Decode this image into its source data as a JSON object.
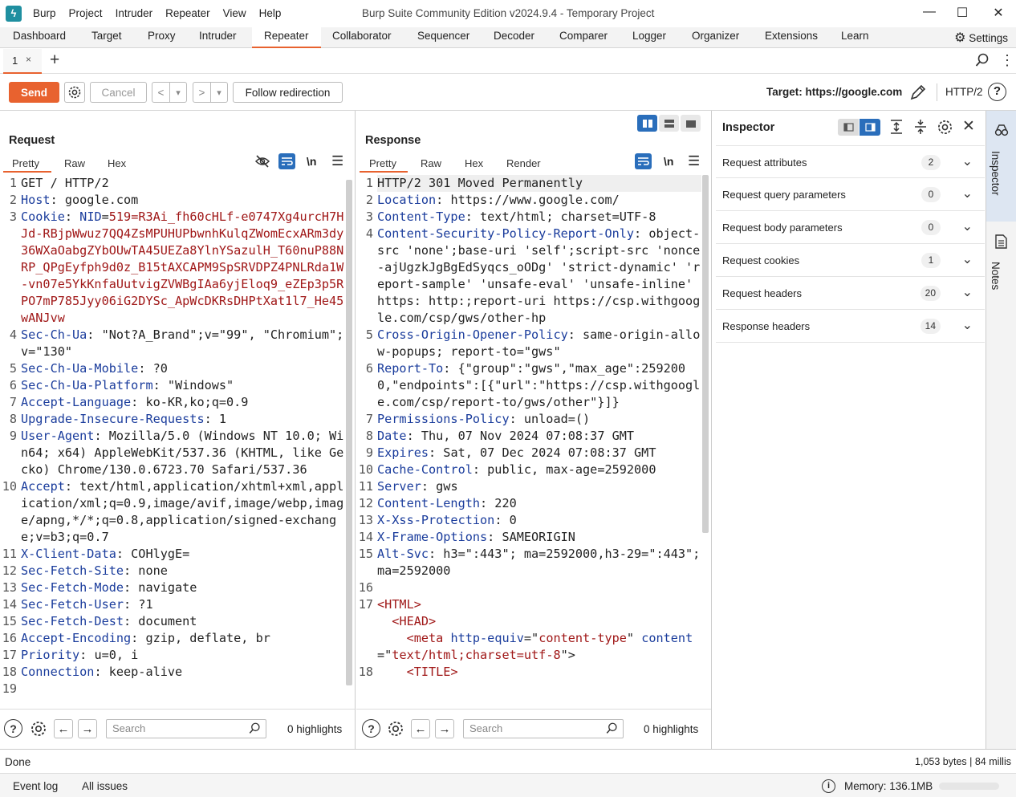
{
  "app": {
    "menu": [
      "Burp",
      "Project",
      "Intruder",
      "Repeater",
      "View",
      "Help"
    ],
    "window_title": "Burp Suite Community Edition v2024.9.4 - Temporary Project",
    "controls": {
      "minimize": "—",
      "maximize": "☐",
      "close": "✕"
    }
  },
  "main_tabs": [
    "Dashboard",
    "Target",
    "Proxy",
    "Intruder",
    "Repeater",
    "Collaborator",
    "Sequencer",
    "Decoder",
    "Comparer",
    "Logger",
    "Organizer",
    "Extensions",
    "Learn"
  ],
  "active_main_tab": "Repeater",
  "settings_label": "Settings",
  "repeater_tabs": [
    {
      "label": "1",
      "close": "×"
    }
  ],
  "add_tab": "+",
  "toolbar": {
    "send": "Send",
    "cancel": "Cancel",
    "back": "<",
    "forward": ">",
    "dropdown": "▾",
    "follow": "Follow redirection",
    "target_label": "Target: https://google.com",
    "protocol": "HTTP/2"
  },
  "request": {
    "title": "Request",
    "tabs": [
      "Pretty",
      "Raw",
      "Hex"
    ],
    "active_tab": "Pretty",
    "newline_toggle": "\\n",
    "lines": [
      {
        "n": "1",
        "parts": [
          [
            "",
            "GET / HTTP/2"
          ]
        ]
      },
      {
        "n": "2",
        "parts": [
          [
            "h",
            "Host"
          ],
          [
            "",
            ": google.com"
          ]
        ]
      },
      {
        "n": "3",
        "parts": [
          [
            "h",
            "Cookie"
          ],
          [
            "",
            ": "
          ],
          [
            "h",
            "NID"
          ],
          [
            "",
            "="
          ],
          [
            "c",
            "519=R3Ai_fh60cHLf-e0747Xg4urcH7HJd-RBjpWwuz7QQ4ZsMPUHUPbwnhKulqZWomEcxARm3dy36WXaOabgZYbOUwTA45UEZa8YlnYSazulH_T60nuP88NRP_QPgEyfph9d0z_B15tAXCAPM9SpSRVDPZ4PNLRda1W-vn07e5YkKnfaUutvigZVWBgIAa6yjEloq9_eZEp3p5RPO7mP785Jyy06iG2DYSc_ApWcDKRsDHPtXat1l7_He45wANJvw"
          ]
        ]
      },
      {
        "n": "4",
        "parts": [
          [
            "h",
            "Sec-Ch-Ua"
          ],
          [
            "",
            ": \"Not?A_Brand\";v=\"99\", \"Chromium\";v=\"130\""
          ]
        ]
      },
      {
        "n": "5",
        "parts": [
          [
            "h",
            "Sec-Ch-Ua-Mobile"
          ],
          [
            "",
            ": ?0"
          ]
        ]
      },
      {
        "n": "6",
        "parts": [
          [
            "h",
            "Sec-Ch-Ua-Platform"
          ],
          [
            "",
            ": \"Windows\""
          ]
        ]
      },
      {
        "n": "7",
        "parts": [
          [
            "h",
            "Accept-Language"
          ],
          [
            "",
            ": ko-KR,ko;q=0.9"
          ]
        ]
      },
      {
        "n": "8",
        "parts": [
          [
            "h",
            "Upgrade-Insecure-Requests"
          ],
          [
            "",
            ": 1"
          ]
        ]
      },
      {
        "n": "9",
        "parts": [
          [
            "h",
            "User-Agent"
          ],
          [
            "",
            ": Mozilla/5.0 (Windows NT 10.0; Win64; x64) AppleWebKit/537.36 (KHTML, like Gecko) Chrome/130.0.6723.70 Safari/537.36"
          ]
        ]
      },
      {
        "n": "10",
        "parts": [
          [
            "h",
            "Accept"
          ],
          [
            "",
            ": text/html,application/xhtml+xml,application/xml;q=0.9,image/avif,image/webp,image/apng,*/*;q=0.8,application/signed-exchange;v=b3;q=0.7"
          ]
        ]
      },
      {
        "n": "11",
        "parts": [
          [
            "h",
            "X-Client-Data"
          ],
          [
            "",
            ": COHlygE="
          ]
        ]
      },
      {
        "n": "12",
        "parts": [
          [
            "h",
            "Sec-Fetch-Site"
          ],
          [
            "",
            ": none"
          ]
        ]
      },
      {
        "n": "13",
        "parts": [
          [
            "h",
            "Sec-Fetch-Mode"
          ],
          [
            "",
            ": navigate"
          ]
        ]
      },
      {
        "n": "14",
        "parts": [
          [
            "h",
            "Sec-Fetch-User"
          ],
          [
            "",
            ": ?1"
          ]
        ]
      },
      {
        "n": "15",
        "parts": [
          [
            "h",
            "Sec-Fetch-Dest"
          ],
          [
            "",
            ": document"
          ]
        ]
      },
      {
        "n": "16",
        "parts": [
          [
            "h",
            "Accept-Encoding"
          ],
          [
            "",
            ": gzip, deflate, br"
          ]
        ]
      },
      {
        "n": "17",
        "parts": [
          [
            "h",
            "Priority"
          ],
          [
            "",
            ": u=0, i"
          ]
        ]
      },
      {
        "n": "18",
        "parts": [
          [
            "h",
            "Connection"
          ],
          [
            "",
            ": keep-alive"
          ]
        ]
      },
      {
        "n": "19",
        "parts": [
          [
            "",
            ""
          ]
        ]
      }
    ],
    "search_placeholder": "Search",
    "highlights": "0 highlights"
  },
  "response": {
    "title": "Response",
    "tabs": [
      "Pretty",
      "Raw",
      "Hex",
      "Render"
    ],
    "active_tab": "Pretty",
    "newline_toggle": "\\n",
    "lines": [
      {
        "n": "1",
        "parts": [
          [
            "",
            "HTTP/2 301 Moved Permanently"
          ]
        ]
      },
      {
        "n": "2",
        "parts": [
          [
            "h",
            "Location"
          ],
          [
            "",
            ": https://www.google.com/"
          ]
        ]
      },
      {
        "n": "3",
        "parts": [
          [
            "h",
            "Content-Type"
          ],
          [
            "",
            ": text/html; charset=UTF-8"
          ]
        ]
      },
      {
        "n": "4",
        "parts": [
          [
            "h",
            "Content-Security-Policy-Report-Only"
          ],
          [
            "",
            ": object-src 'none';base-uri 'self';script-src 'nonce-ajUgzkJgBgEdSyqcs_oODg' 'strict-dynamic' 'report-sample' 'unsafe-eval' 'unsafe-inline' https: http:;report-uri https://csp.withgoogle.com/csp/gws/other-hp"
          ]
        ]
      },
      {
        "n": "5",
        "parts": [
          [
            "h",
            "Cross-Origin-Opener-Policy"
          ],
          [
            "",
            ": same-origin-allow-popups; report-to=\"gws\""
          ]
        ]
      },
      {
        "n": "6",
        "parts": [
          [
            "h",
            "Report-To"
          ],
          [
            "",
            ": {\"group\":\"gws\",\"max_age\":2592000,\"endpoints\":[{\"url\":\"https://csp.withgoogle.com/csp/report-to/gws/other\"}]}"
          ]
        ]
      },
      {
        "n": "7",
        "parts": [
          [
            "h",
            "Permissions-Policy"
          ],
          [
            "",
            ": unload=()"
          ]
        ]
      },
      {
        "n": "8",
        "parts": [
          [
            "h",
            "Date"
          ],
          [
            "",
            ": Thu, 07 Nov 2024 07:08:37 GMT"
          ]
        ]
      },
      {
        "n": "9",
        "parts": [
          [
            "h",
            "Expires"
          ],
          [
            "",
            ": Sat, 07 Dec 2024 07:08:37 GMT"
          ]
        ]
      },
      {
        "n": "10",
        "parts": [
          [
            "h",
            "Cache-Control"
          ],
          [
            "",
            ": public, max-age=2592000"
          ]
        ]
      },
      {
        "n": "11",
        "parts": [
          [
            "h",
            "Server"
          ],
          [
            "",
            ": gws"
          ]
        ]
      },
      {
        "n": "12",
        "parts": [
          [
            "h",
            "Content-Length"
          ],
          [
            "",
            ": 220"
          ]
        ]
      },
      {
        "n": "13",
        "parts": [
          [
            "h",
            "X-Xss-Protection"
          ],
          [
            "",
            ": 0"
          ]
        ]
      },
      {
        "n": "14",
        "parts": [
          [
            "h",
            "X-Frame-Options"
          ],
          [
            "",
            ": SAMEORIGIN"
          ]
        ]
      },
      {
        "n": "15",
        "parts": [
          [
            "h",
            "Alt-Svc"
          ],
          [
            "",
            ": h3=\":443\"; ma=2592000,h3-29=\":443\"; ma=2592000"
          ]
        ]
      },
      {
        "n": "16",
        "parts": [
          [
            "",
            ""
          ]
        ]
      },
      {
        "n": "17",
        "parts": [
          [
            "t",
            "<HTML>"
          ]
        ]
      },
      {
        "n": "",
        "parts": [
          [
            "",
            "  "
          ],
          [
            "t",
            "<HEAD>"
          ]
        ]
      },
      {
        "n": "",
        "parts": [
          [
            "",
            "    "
          ],
          [
            "t",
            "<meta "
          ],
          [
            "a",
            "http-equiv"
          ],
          [
            "",
            "=\""
          ],
          [
            "t",
            "content-type"
          ],
          [
            "",
            "\" "
          ],
          [
            "a",
            "content"
          ],
          [
            "",
            "=\""
          ],
          [
            "t",
            "text/html;charset=utf-8"
          ],
          [
            "",
            "\">"
          ]
        ]
      },
      {
        "n": "18",
        "parts": [
          [
            "",
            "    "
          ],
          [
            "t",
            "<TITLE>"
          ]
        ]
      }
    ],
    "search_placeholder": "Search",
    "highlights": "0 highlights"
  },
  "inspector": {
    "title": "Inspector",
    "rows": [
      {
        "label": "Request attributes",
        "count": "2"
      },
      {
        "label": "Request query parameters",
        "count": "0"
      },
      {
        "label": "Request body parameters",
        "count": "0"
      },
      {
        "label": "Request cookies",
        "count": "1"
      },
      {
        "label": "Request headers",
        "count": "20"
      },
      {
        "label": "Response headers",
        "count": "14"
      }
    ]
  },
  "side_tabs": [
    "Inspector",
    "Notes"
  ],
  "status": {
    "left": "Done",
    "right": "1,053 bytes | 84 millis"
  },
  "footer": {
    "event_log": "Event log",
    "all_issues": "All issues",
    "memory": "Memory: 136.1MB"
  },
  "colors": {
    "accent": "#e8622f",
    "header_name": "#1a3c9c",
    "cookie_value": "#a01818",
    "toggle_blue": "#2a6ebb"
  }
}
